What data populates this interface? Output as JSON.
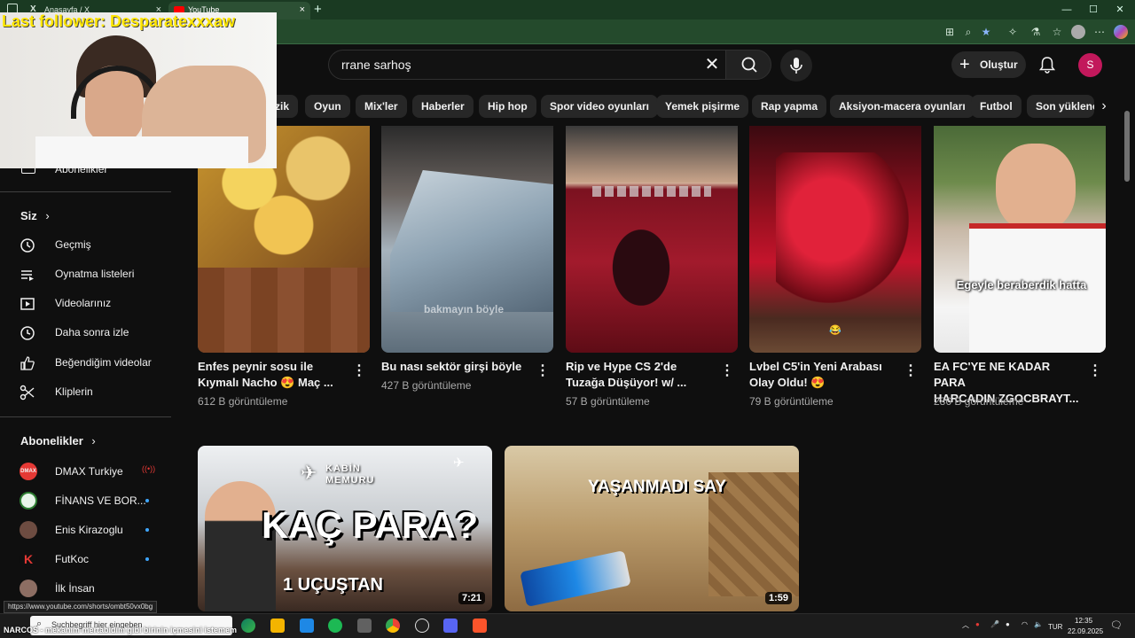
{
  "browser": {
    "tabs": [
      {
        "title": "Anasayfa / X"
      },
      {
        "title": "YouTube"
      }
    ],
    "new_tab": "+",
    "controls": {
      "minimize": "—",
      "maximize": "☐",
      "close": "✕"
    }
  },
  "header": {
    "search_value": "rrane sarhoş",
    "create_label": "Oluştur",
    "avatar_letter": "S"
  },
  "chips": [
    "zik",
    "Oyun",
    "Mix'ler",
    "Haberler",
    "Hip hop",
    "Spor video oyunları",
    "Yemek pişirme",
    "Rap yapma",
    "Aksiyon-macera oyunları",
    "Futbol",
    "Son yüklene"
  ],
  "sidebar": {
    "subscriptions_cut": "Abonelikler",
    "you_header": "Siz",
    "you_items": [
      {
        "label": "Geçmiş",
        "icon": "history-icon"
      },
      {
        "label": "Oynatma listeleri",
        "icon": "playlist-icon"
      },
      {
        "label": "Videolarınız",
        "icon": "your-videos-icon"
      },
      {
        "label": "Daha sonra izle",
        "icon": "watch-later-icon"
      },
      {
        "label": "Beğendiğim videolar",
        "icon": "thumbs-up-icon"
      },
      {
        "label": "Kliplerin",
        "icon": "clips-icon"
      }
    ],
    "subs_header": "Abonelikler",
    "channels": [
      {
        "name": "DMAX Turkiye",
        "color": "#e53935",
        "live": true
      },
      {
        "name": "FİNANS VE BOR...",
        "color": "#2e7d32",
        "live": false
      },
      {
        "name": "Enis Kirazoglu",
        "color": "#6d4c41",
        "live": false
      },
      {
        "name": "FutKoc",
        "color": "#c62828",
        "live": false
      },
      {
        "name": "İlk İnsan",
        "color": "#8d6e63",
        "live": false
      }
    ]
  },
  "videos_row1": [
    {
      "title_line1": "Enfes peynir sosu ile",
      "title_line2": "Kıymalı Nacho 😍  Maç ...",
      "views": "612 B görüntüleme"
    },
    {
      "title_line1": "Bu nası sektör girşi böyle",
      "title_line2": "",
      "views": "427 B görüntüleme",
      "overlay": "bakmayın böyle"
    },
    {
      "title_line1": "Rip ve Hype CS 2'de",
      "title_line2": "Tuzağa Düşüyor! w/ ...",
      "views": "57 B görüntüleme"
    },
    {
      "title_line1": "Lvbel C5'in Yeni Arabası",
      "title_line2": "Olay Oldu! 😍",
      "views": "79 B görüntüleme"
    },
    {
      "title_line1": "EA FC'YE NE KADAR PARA",
      "title_line2": "HARCADIN ZGOCBRAYT...",
      "views": "286 B görüntüleme",
      "overlay": "Egeyle beraberdik hatta"
    }
  ],
  "videos_row2": [
    {
      "thumb_big": "KAÇ PARA?",
      "thumb_small": "KABİN MEMURU",
      "thumb_bottom": "1 UÇUŞTAN",
      "duration": "7:21"
    },
    {
      "thumb_big": "YAŞANMADI SAY",
      "duration": "1:59"
    }
  ],
  "overlay": {
    "follower_text": "Last follower: Desparatexxxaw"
  },
  "status_url": "https://www.youtube.com/shorts/ombt50vx0bg",
  "taskbar": {
    "search_placeholder": "Suchbegriff hier eingeben",
    "ticker": "NARCOS - mekanım mertabidim gibi birinin içmesini istemem",
    "lang": "TUR",
    "time": "12:35",
    "date": "22.09.2025"
  }
}
